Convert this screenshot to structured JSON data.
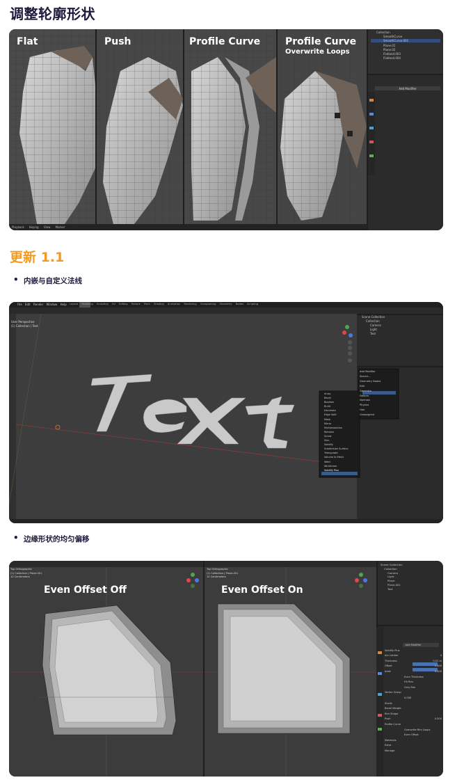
{
  "title": "调整轮廓形状",
  "update_title": "更新 1.1",
  "bullets": [
    "内嵌与自定义法线",
    "边缘形状的均匀偏移"
  ],
  "shot1": {
    "panels": [
      "Flat",
      "Push",
      "Profile Curve",
      "Profile Curve"
    ],
    "panel4_sub": "Overwrite Loops",
    "outliner": [
      "Collection",
      "SmoothCurve",
      "SmoothCurve.001",
      "Plane.01",
      "Plane.02",
      "Flatland.003",
      "Flatland.004"
    ],
    "modifier_label": "Add Modifier",
    "timeline": [
      "Playback",
      "Keying",
      "View",
      "Marker"
    ]
  },
  "shot2": {
    "menu": [
      "File",
      "Edit",
      "Render",
      "Window",
      "Help"
    ],
    "workspaces": [
      "Layout",
      "Modeling",
      "Sculpting",
      "UV Editing",
      "Texture Paint",
      "Shading",
      "Animation",
      "Rendering",
      "Compositing",
      "Geometry Nodes",
      "Scripting"
    ],
    "viewport_info": [
      "User Perspective",
      "(1) Collection | Text"
    ],
    "viewport_word": "Text",
    "outliner": [
      "Scene Collection",
      "Collection",
      "Camera",
      "Light",
      "Text"
    ],
    "add_modifier_menu": {
      "header": "Add Modifier",
      "search": "Search...",
      "categories": [
        "Geometry Nodes",
        "Edit",
        "Generate",
        "Deform",
        "Normals",
        "Physics",
        "Hair",
        "Unassigned"
      ],
      "generate_items": [
        "Array",
        "Bevel",
        "Boolean",
        "Build",
        "Decimate",
        "Edge Split",
        "Mask",
        "Mirror",
        "Multiresolution",
        "Remesh",
        "Screw",
        "Skin",
        "Solidify",
        "Subdivision Surface",
        "Triangulate",
        "Volume to Mesh",
        "Weld",
        "Wireframe",
        "Solidify Plus"
      ]
    }
  },
  "shot3": {
    "left_label": "Even Offset Off",
    "right_label": "Even Offset On",
    "viewport_info": [
      "Top Orthographic",
      "(1) Collection | Plane.001",
      "10 Centimeters"
    ],
    "outliner": [
      "Scene Collection",
      "Collection",
      "Camera",
      "Light",
      "Plane",
      "Plane.001",
      "Text"
    ],
    "modifier": {
      "add": "Add Modifier",
      "name": "Solidify Plus",
      "fields": [
        {
          "label": "Arc Limiter",
          "value": "4"
        },
        {
          "label": "Thickness",
          "value": "0.01 m"
        },
        {
          "label": "Offset",
          "value": "-1.000"
        },
        {
          "label": "Inset",
          "value": "0.000"
        }
      ],
      "checks": [
        "Even Thickness",
        "Fill Rim",
        "Only Rim"
      ],
      "vertex_group": "Vertex Group",
      "factor": "0.000",
      "sections": [
        "Shells",
        "Bevel Weight",
        "Rim Shape",
        "Materials",
        "Extra",
        "Manage"
      ],
      "rim": {
        "label": "Push",
        "value": "0.500"
      },
      "profile": "Profile Curve",
      "overwrite": "Overwrite Rim Loops",
      "even_offset": "Even Offset"
    }
  }
}
